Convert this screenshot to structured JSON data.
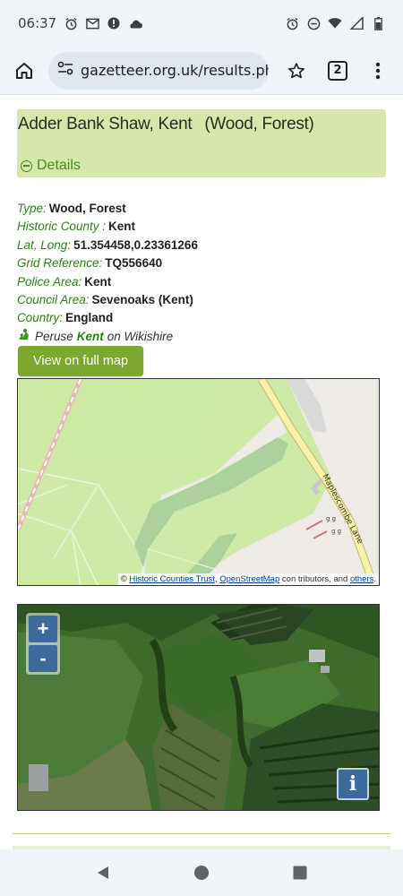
{
  "status_bar": {
    "time": "06:37",
    "left_icons": [
      "alarm-icon",
      "mail-icon",
      "alert-icon",
      "cloud-icon"
    ],
    "right_icons": [
      "alarm-icon",
      "dnd-icon",
      "wifi-icon",
      "signal-icon",
      "battery-icon"
    ]
  },
  "browser": {
    "url": "gazetteer.org.uk/results.php",
    "tab_count": "2"
  },
  "place": {
    "name": "Adder Bank Shaw, Kent",
    "type_label": "(Wood, Forest)",
    "details_label": "Details"
  },
  "info": {
    "rows": [
      {
        "label": "Type:",
        "value": "Wood, Forest"
      },
      {
        "label": "Historic County :",
        "value": "Kent"
      },
      {
        "label": "Lat, Long:",
        "value": "51.354458,0.23361266"
      },
      {
        "label": "Grid Reference:",
        "value": "TQ556640"
      },
      {
        "label": "Police Area:",
        "value": "Kent"
      },
      {
        "label": "Council Area:",
        "value": "Sevenoaks (Kent)"
      },
      {
        "label": "Country:",
        "value": "England"
      }
    ],
    "peruse_prefix": "Peruse",
    "peruse_link": "Kent",
    "peruse_suffix": "on Wikishire"
  },
  "map_button": "View on full map",
  "street_map": {
    "road_label": "Maplescombe Lane",
    "attribution_prefix": "©",
    "attribution_link1": "Historic Counties Trust",
    "attribution_sep": ",",
    "attribution_link2": "OpenStreetMap",
    "attribution_middle": "con tributors, and",
    "attribution_link3": "others",
    "attribution_end": "."
  },
  "sat_map": {
    "zoom_in": "+",
    "zoom_out": "-",
    "info": "i"
  },
  "colors": {
    "title_bg": "#d7e7a9",
    "label_green": "#2f7d18",
    "button_green": "#7ea72f",
    "map_control_blue": "#3d6a9c"
  }
}
